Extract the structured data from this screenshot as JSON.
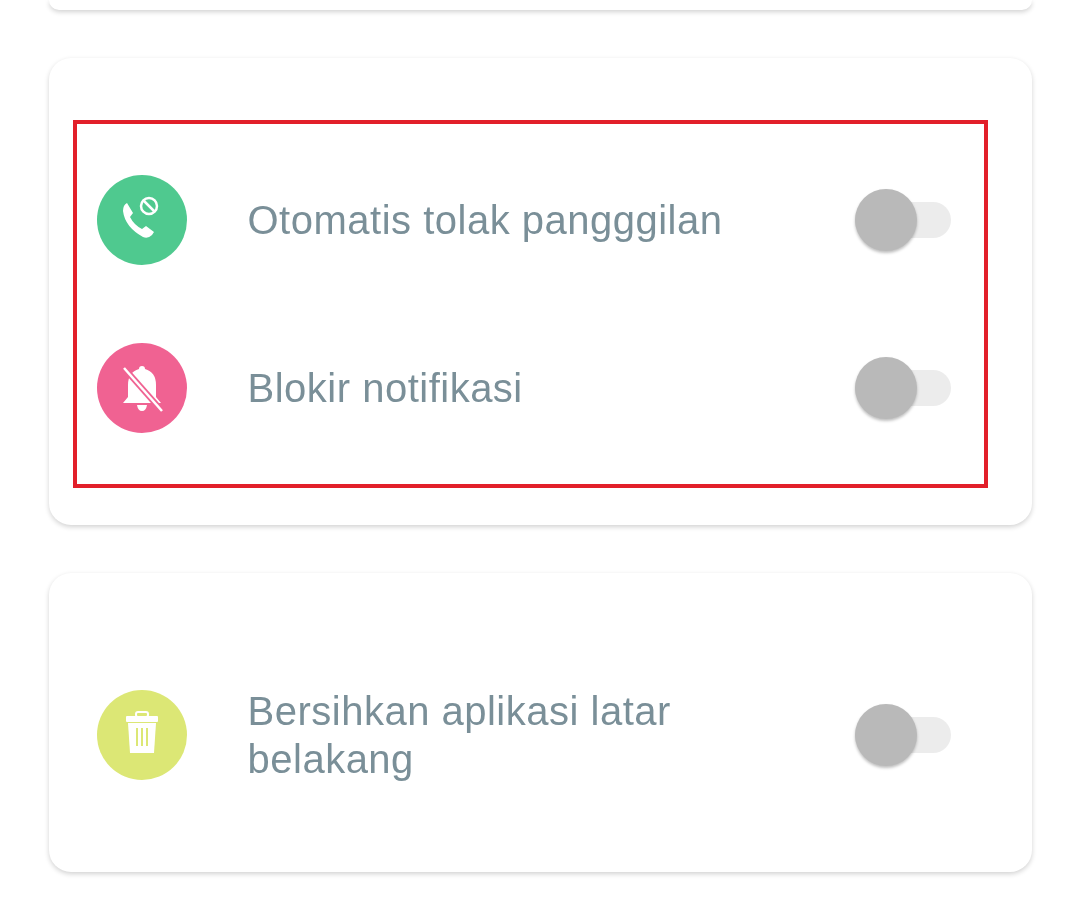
{
  "cards": [
    {
      "highlighted": true,
      "items": [
        {
          "kind": "call-block",
          "color": "#4fc98f",
          "label": "Otomatis tolak pangggilan",
          "on": false
        },
        {
          "kind": "bell-off",
          "color": "#f06292",
          "label": "Blokir notifikasi",
          "on": false
        }
      ]
    },
    {
      "highlighted": false,
      "items": [
        {
          "kind": "trash",
          "color": "#dce775",
          "label": "Bersihkan aplikasi latar belakang",
          "on": false
        }
      ]
    }
  ]
}
